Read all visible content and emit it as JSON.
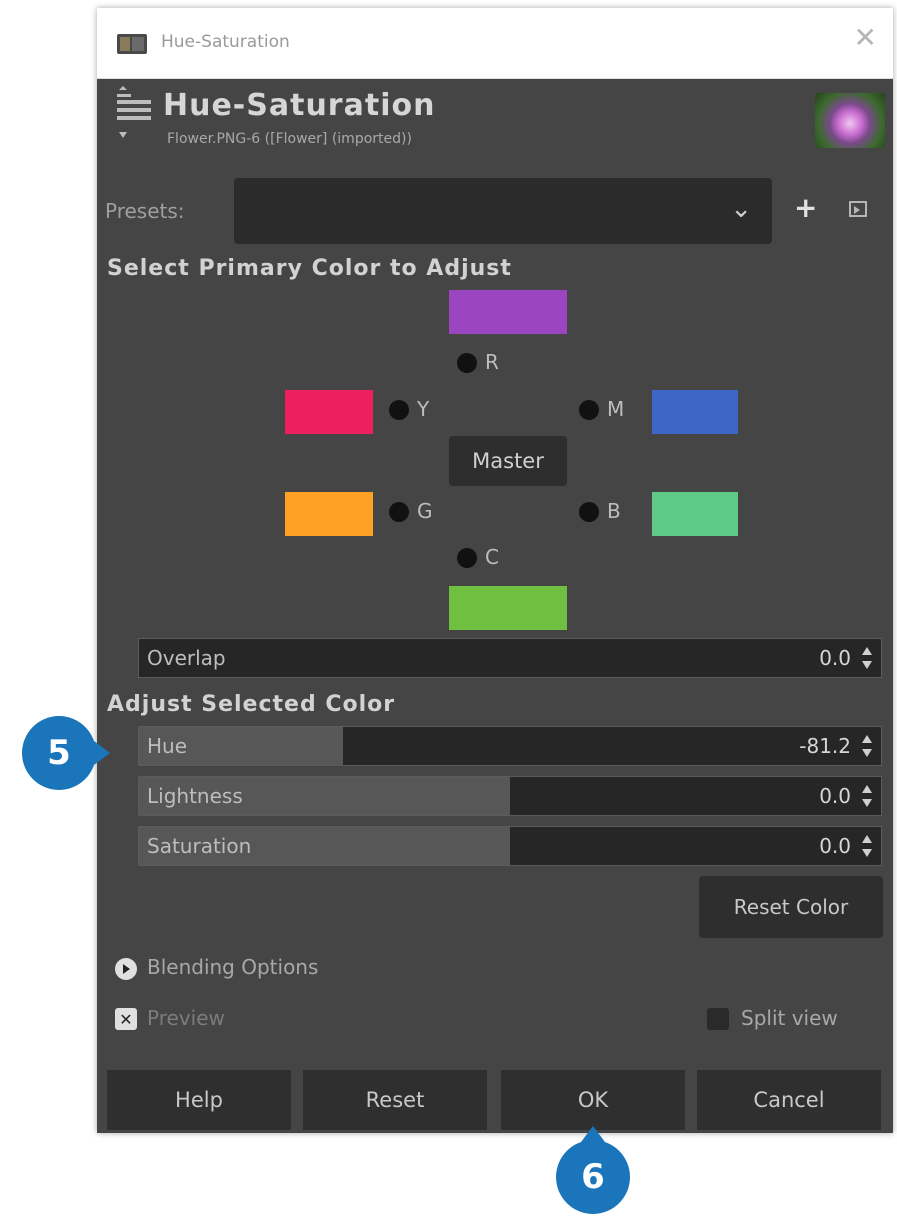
{
  "window": {
    "title": "Hue-Saturation",
    "close_glyph": "✕"
  },
  "header": {
    "title": "Hue-Saturation",
    "subtitle": "Flower.PNG-6 ([Flower] (imported))"
  },
  "presets": {
    "label": "Presets:",
    "value": "",
    "add_glyph": "+",
    "chevron_glyph": "⌄"
  },
  "primary": {
    "section_title": "Select Primary Color to Adjust",
    "master_label": "Master",
    "colors": [
      {
        "label": "R",
        "swatch": "#9b45c0"
      },
      {
        "label": "Y",
        "swatch": "#ec1f5f"
      },
      {
        "label": "G",
        "swatch": "#ffa125"
      },
      {
        "label": "C",
        "swatch": "#6fc040"
      },
      {
        "label": "B",
        "swatch": "#5fca87"
      },
      {
        "label": "M",
        "swatch": "#3e66c7"
      }
    ],
    "selected": "Master"
  },
  "overlap": {
    "label": "Overlap",
    "value": "0.0",
    "fill_fraction": 0.0
  },
  "adjust": {
    "section_title": "Adjust Selected Color",
    "hue": {
      "label": "Hue",
      "value": "-81.2",
      "fill_fraction": 0.275
    },
    "lightness": {
      "label": "Lightness",
      "value": "0.0",
      "fill_fraction": 0.5
    },
    "saturation": {
      "label": "Saturation",
      "value": "0.0",
      "fill_fraction": 0.5
    },
    "reset_color_label": "Reset Color"
  },
  "blending": {
    "label": "Blending Options",
    "expanded": false
  },
  "preview": {
    "label": "Preview",
    "checked": true,
    "check_glyph": "✕"
  },
  "split_view": {
    "label": "Split view",
    "checked": false
  },
  "buttons": {
    "help": "Help",
    "reset": "Reset",
    "ok": "OK",
    "cancel": "Cancel"
  },
  "callouts": {
    "step5": "5",
    "step6": "6",
    "color": "#1b75bb"
  }
}
